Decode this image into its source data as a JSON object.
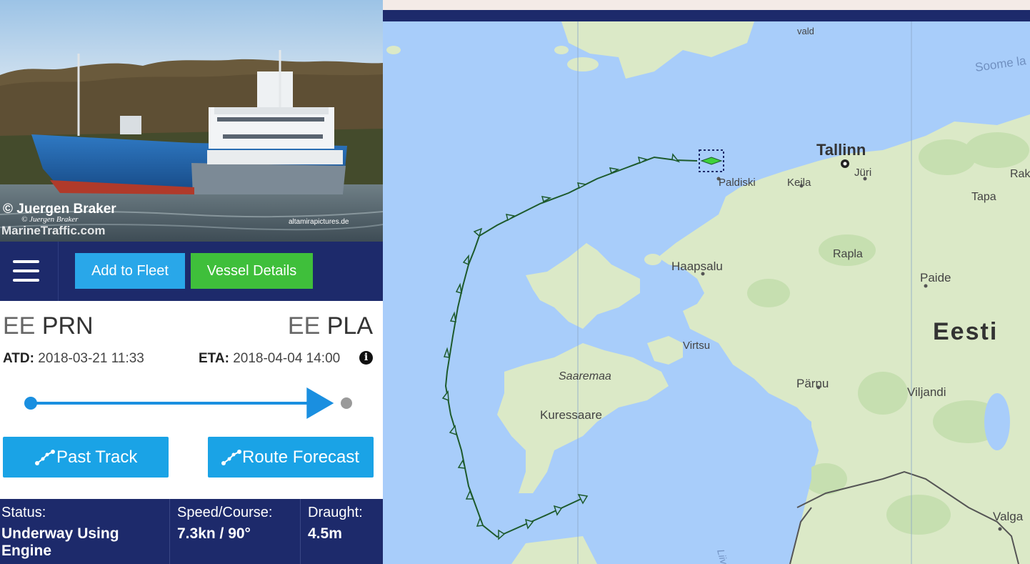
{
  "photo": {
    "credit_line1": "© Juergen Braker",
    "credit_line2": "© Juergen Braker",
    "watermark": "MarineTraffic.com",
    "source_site": "altamirapictures.de"
  },
  "toolbar": {
    "add_to_fleet": "Add to Fleet",
    "vessel_details": "Vessel Details"
  },
  "voyage": {
    "from_country": "EE",
    "from_port": "PRN",
    "to_country": "EE",
    "to_port": "PLA",
    "atd_label": "ATD:",
    "atd_value": "2018-03-21 11:33",
    "eta_label": "ETA:",
    "eta_value": "2018-04-04 14:00",
    "info_icon_glyph": "i",
    "progress_fraction": 0.96
  },
  "buttons": {
    "past_track": "Past Track",
    "route_forecast": "Route Forecast"
  },
  "stats": {
    "status_label": "Status:",
    "status_value_line1": "Underway Using",
    "status_value_line2": "Engine",
    "speed_label": "Speed/Course:",
    "speed_value": "7.3kn / 90°",
    "draught_label": "Draught:",
    "draught_value": "4.5m"
  },
  "map": {
    "labels": {
      "vald": "vald",
      "soome_laht": "Soome la",
      "tallinn": "Tallinn",
      "juri": "Jüri",
      "paldiski": "Paldiski",
      "keila": "Keila",
      "rak": "Rak",
      "tapa": "Tapa",
      "rapla": "Rapla",
      "haapsalu": "Haapsalu",
      "paide": "Paide",
      "eesti": "Eesti",
      "virtsu": "Virtsu",
      "saaremaa": "Saaremaa",
      "parnu": "Pärnu",
      "viljandi": "Viljandi",
      "kuressaare": "Kuressaare",
      "valga": "Valga",
      "liivi_laht": "Liivi laht"
    },
    "colors": {
      "water": "#a8cdfa",
      "land": "#dbe9c7",
      "track": "#1d5a2c",
      "vessel": "#3fd23a"
    }
  }
}
